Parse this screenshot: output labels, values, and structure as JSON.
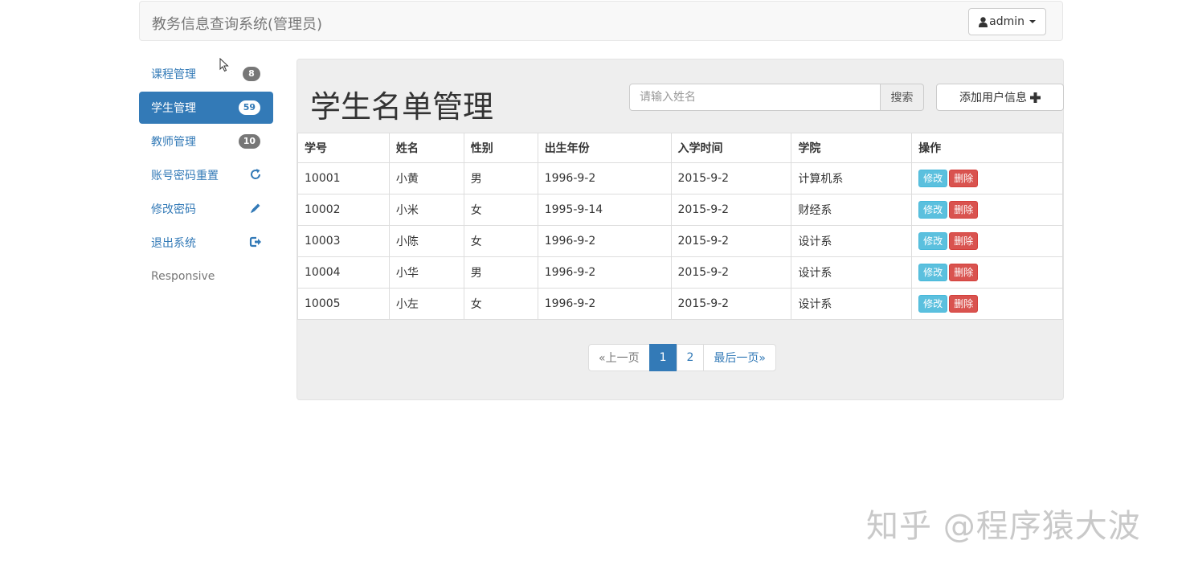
{
  "navbar": {
    "brand": "教务信息查询系统(管理员)",
    "user_label": "admin"
  },
  "sidebar": {
    "items": [
      {
        "label": "课程管理",
        "badge": "8"
      },
      {
        "label": "学生管理",
        "badge": "59"
      },
      {
        "label": "教师管理",
        "badge": "10"
      },
      {
        "label": "账号密码重置",
        "icon": "refresh-icon"
      },
      {
        "label": "修改密码",
        "icon": "pencil-icon"
      },
      {
        "label": "退出系统",
        "icon": "logout-icon"
      },
      {
        "label": "Responsive"
      }
    ]
  },
  "main": {
    "title": "学生名单管理",
    "search_placeholder": "请输入姓名",
    "search_button": "搜索",
    "add_button": "添加用户信息",
    "columns": [
      "学号",
      "姓名",
      "性别",
      "出生年份",
      "入学时间",
      "学院",
      "操作"
    ],
    "rows": [
      [
        "10001",
        "小黄",
        "男",
        "1996-9-2",
        "2015-9-2",
        "计算机系"
      ],
      [
        "10002",
        "小米",
        "女",
        "1995-9-14",
        "2015-9-2",
        "财经系"
      ],
      [
        "10003",
        "小陈",
        "女",
        "1996-9-2",
        "2015-9-2",
        "设计系"
      ],
      [
        "10004",
        "小华",
        "男",
        "1996-9-2",
        "2015-9-2",
        "设计系"
      ],
      [
        "10005",
        "小左",
        "女",
        "1996-9-2",
        "2015-9-2",
        "设计系"
      ]
    ],
    "edit_label": "修改",
    "delete_label": "删除"
  },
  "pagination": {
    "prev": "«上一页",
    "pages": [
      "1",
      "2"
    ],
    "current": "1",
    "last": "最后一页»"
  },
  "watermark": "知乎 @程序猿大波",
  "colors": {
    "primary": "#337ab7",
    "info": "#5bc0de",
    "danger": "#d9534f"
  }
}
